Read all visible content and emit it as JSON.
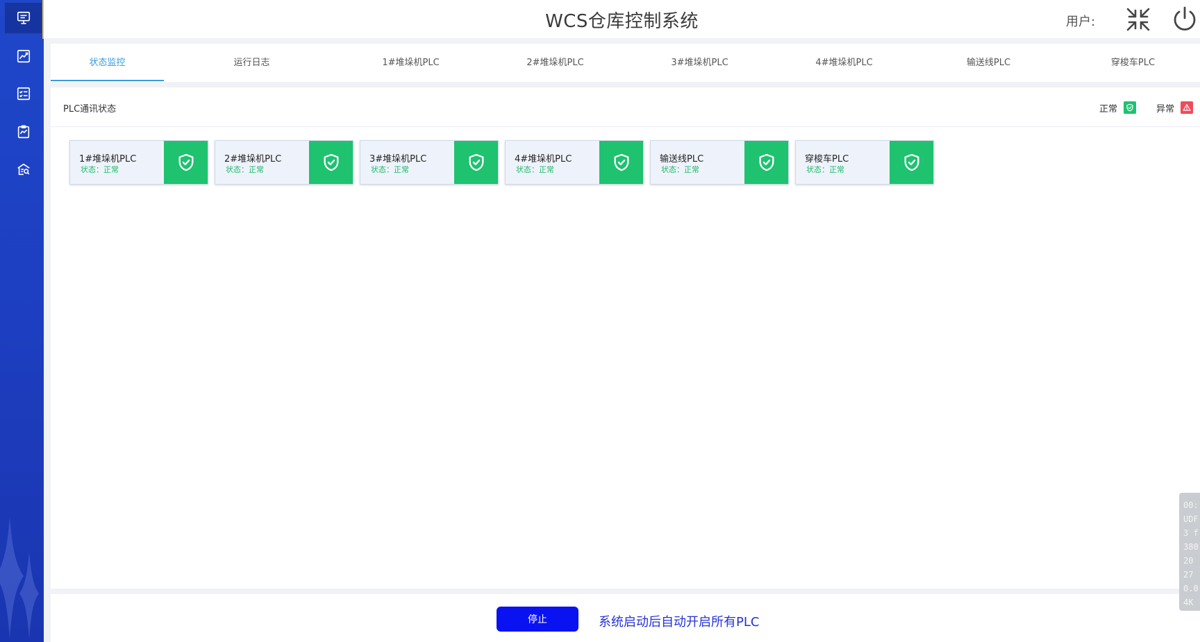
{
  "app": {
    "title": "WCS仓库控制系统",
    "user_label": "用户:"
  },
  "sidebar": {
    "items": [
      {
        "icon": "monitor-icon",
        "active": true
      },
      {
        "icon": "chart-icon",
        "active": false
      },
      {
        "icon": "checklist-icon",
        "active": false
      },
      {
        "icon": "clipboard-chart-icon",
        "active": false
      },
      {
        "icon": "warehouse-search-icon",
        "active": false
      }
    ]
  },
  "header": {
    "collapse_icon": "collapse-arrows-icon",
    "power_icon": "power-icon"
  },
  "tabs": [
    {
      "label": "状态监控",
      "active": true
    },
    {
      "label": "运行日志",
      "active": false
    },
    {
      "label": "1#堆垛机PLC",
      "active": false
    },
    {
      "label": "2#堆垛机PLC",
      "active": false
    },
    {
      "label": "3#堆垛机PLC",
      "active": false
    },
    {
      "label": "4#堆垛机PLC",
      "active": false
    },
    {
      "label": "输送线PLC",
      "active": false
    },
    {
      "label": "穿梭车PLC",
      "active": false
    }
  ],
  "panel": {
    "title": "PLC通讯状态",
    "legend": {
      "normal_label": "正常",
      "normal_color": "#1ec26f",
      "abnormal_label": "异常",
      "abnormal_color": "#f04b5a"
    }
  },
  "plc_cards": [
    {
      "name": "1#堆垛机PLC",
      "status": "状态：正常",
      "icon": "shield-check-icon"
    },
    {
      "name": "2#堆垛机PLC",
      "status": "状态：正常",
      "icon": "shield-check-icon"
    },
    {
      "name": "3#堆垛机PLC",
      "status": "状态：正常",
      "icon": "shield-check-icon"
    },
    {
      "name": "4#堆垛机PLC",
      "status": "状态：正常",
      "icon": "shield-check-icon"
    },
    {
      "name": "输送线PLC",
      "status": "状态：正常",
      "icon": "shield-check-icon"
    },
    {
      "name": "穿梭车PLC",
      "status": "状态：正常",
      "icon": "shield-check-icon"
    }
  ],
  "footer": {
    "stop_label": "停止",
    "note": "系统启动后自动开启所有PLC"
  },
  "overlay": {
    "lines": [
      "00:",
      "UDF",
      "3 f",
      "380",
      "20",
      "27",
      "0.0",
      "4K"
    ]
  },
  "colors": {
    "accent": "#3a9ad9",
    "sidebar": "#1d3fc2",
    "ok_green": "#1ec26f",
    "stop_button": "#0a12f2"
  }
}
